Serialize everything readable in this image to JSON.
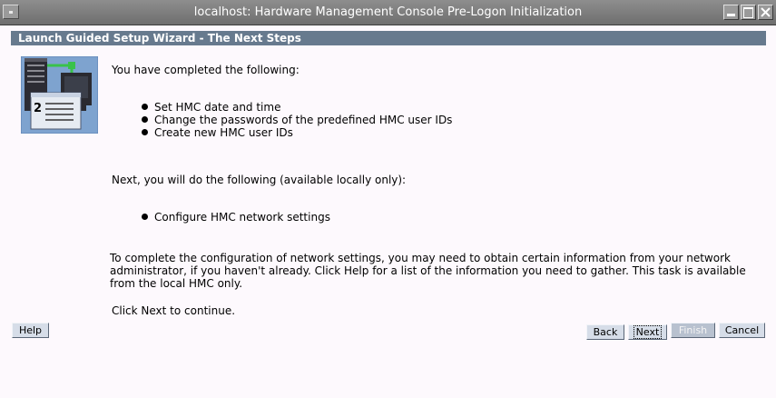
{
  "window": {
    "title": "localhost: Hardware Management Console Pre-Logon Initialization"
  },
  "header": {
    "title": "Launch Guided Setup Wizard - The Next Steps"
  },
  "content": {
    "completed_intro": "You have completed the following:",
    "completed_items": [
      "Set HMC date and time",
      "Change the passwords of the predefined HMC user IDs",
      "Create new HMC user IDs"
    ],
    "next_intro": "Next, you will do the following (available locally only):",
    "next_items": [
      "Configure HMC network settings"
    ],
    "paragraph": "To complete the configuration of network settings, you may need to obtain certain information from your network administrator, if you haven't already. Click Help for a list of the information you need to gather. This task is available from the local HMC only.",
    "continue_text": "Click Next to continue."
  },
  "wizard_icon": {
    "name": "server-computer-icon",
    "step_number": "2"
  },
  "buttons": {
    "help": "Help",
    "back": "Back",
    "next": "Next",
    "finish": "Finish",
    "cancel": "Cancel"
  },
  "colors": {
    "header_bar": "#677a8e",
    "page_background": "#fdf9fd",
    "title_bar": "#7e7e7e",
    "button_face": "#d6dde8"
  }
}
